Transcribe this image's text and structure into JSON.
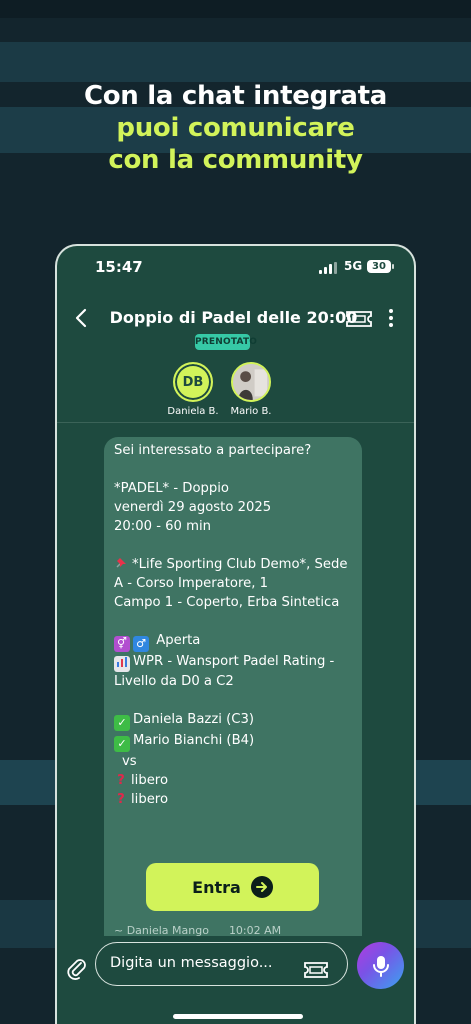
{
  "promo": {
    "line1": "Con la chat integrata",
    "line2": "puoi comunicare",
    "line3": "con la community"
  },
  "status_bar": {
    "time": "15:47",
    "network": "5G",
    "battery": "30"
  },
  "header": {
    "title": "Doppio di Padel delle 20:00",
    "badge": "PRENOTATO"
  },
  "participants": [
    {
      "initials": "DB",
      "name": "Daniela B."
    },
    {
      "initials": "",
      "name": "Mario B."
    }
  ],
  "message": {
    "lines": {
      "l1": "Sei interessato a partecipare?",
      "l2": "*PADEL* - Doppio",
      "l3": "venerdì 29 agosto 2025",
      "l4": "20:00 - 60 min",
      "l5": "*Life Sporting Club Demo*, Sede",
      "l6": "A - Corso Imperatore, 1",
      "l7": "Campo 1 - Coperto, Erba Sintetica",
      "l8": "Aperta",
      "l9": "WPR - Wansport Padel Rating -",
      "l10": "Livello da D0 a C2",
      "l11": "Daniela Bazzi (C3)",
      "l12": "Mario Bianchi (B4)",
      "l13": "vs",
      "l14": "libero",
      "l15": "libero"
    },
    "button_label": "Entra",
    "sender": "~ Daniela Mango",
    "timestamp": "10:02 AM"
  },
  "composer": {
    "placeholder": "Digita un messaggio..."
  },
  "colors": {
    "accent": "#d2f35a",
    "chat_bg": "#1e4a3f",
    "bubble": "#3f7463",
    "badge": "#36c9a6"
  },
  "icons": [
    "back-arrow-icon",
    "ticket-icon",
    "more-vertical-icon",
    "pin-icon",
    "gender-icon",
    "chart-icon",
    "check-icon",
    "question-icon",
    "arrow-right-icon",
    "paperclip-icon",
    "microphone-icon"
  ]
}
